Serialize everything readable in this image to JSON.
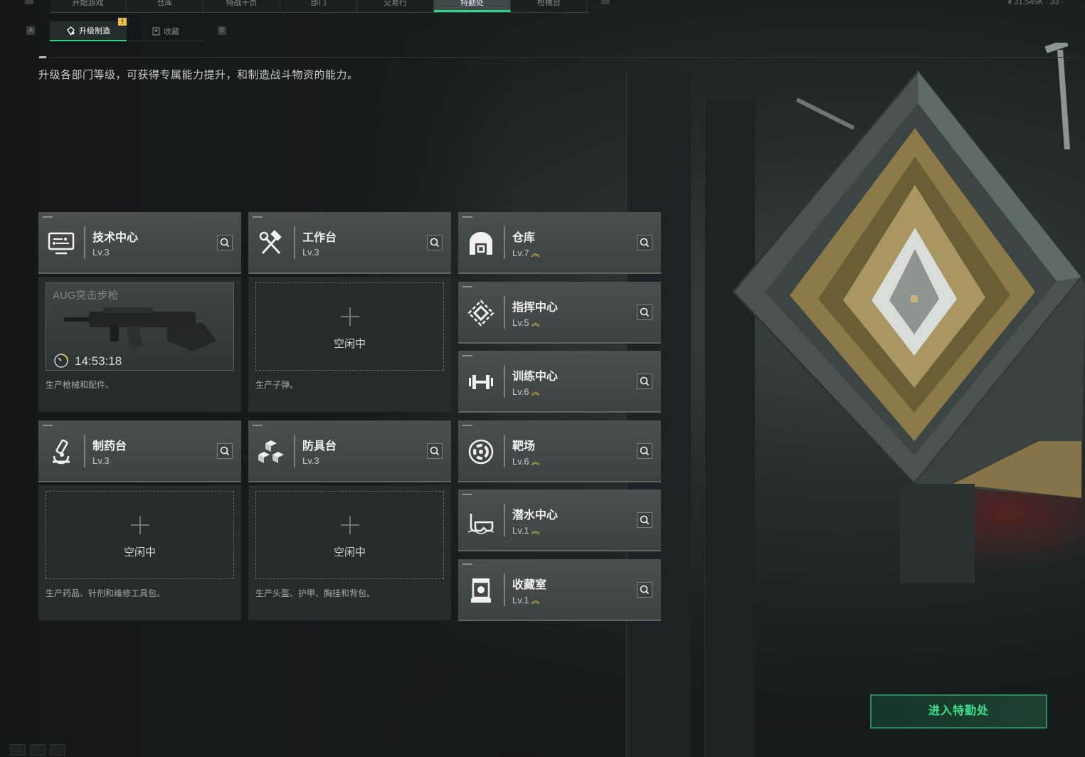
{
  "nav": {
    "key_left": "A",
    "key_right": "D",
    "tabs": [
      {
        "label": "开始游戏",
        "active": false
      },
      {
        "label": "仓库",
        "active": false
      },
      {
        "label": "特战干员",
        "active": false
      },
      {
        "label": "部门",
        "active": false
      },
      {
        "label": "交易行",
        "active": false
      },
      {
        "label": "特勤处",
        "active": true
      },
      {
        "label": "枪械台",
        "active": false
      }
    ],
    "currency": "¥ 31,545K · 33 ·"
  },
  "subtabs": {
    "upgrade_label": "升级制造",
    "upgrade_badge": "!",
    "collection_label": "收藏"
  },
  "description": "升级各部门等级，可获得专属能力提升，和制造战斗物资的能力。",
  "stations": {
    "tech_center": {
      "name": "技术中心",
      "level": "Lv.3",
      "icon": "monitor-icon",
      "crafting": {
        "item": "AUG突击步枪",
        "timer": "14:53:18"
      },
      "desc": "生产枪械和配件。"
    },
    "workbench": {
      "name": "工作台",
      "level": "Lv.3",
      "icon": "hammer-wrench-icon",
      "idle": "空闲中",
      "desc": "生产子弹。"
    },
    "pharmacy": {
      "name": "制药台",
      "level": "Lv.3",
      "icon": "microscope-icon",
      "idle": "空闲中",
      "desc": "生产药品、针剂和维修工具包。"
    },
    "armor_bench": {
      "name": "防具台",
      "level": "Lv.3",
      "icon": "blocks-icon",
      "idle": "空闲中",
      "desc": "生产头盔、护甲、胸挂和背包。"
    }
  },
  "departments": [
    {
      "name": "仓库",
      "level": "Lv.7",
      "upgradable": true,
      "icon": "warehouse-icon"
    },
    {
      "name": "指挥中心",
      "level": "Lv.5",
      "upgradable": true,
      "icon": "command-icon"
    },
    {
      "name": "训练中心",
      "level": "Lv.6",
      "upgradable": true,
      "icon": "dumbbell-icon"
    },
    {
      "name": "靶场",
      "level": "Lv.6",
      "upgradable": true,
      "icon": "target-icon"
    },
    {
      "name": "潜水中心",
      "level": "Lv.1",
      "upgradable": true,
      "icon": "diving-mask-icon"
    },
    {
      "name": "收藏室",
      "level": "Lv.1",
      "upgradable": true,
      "icon": "display-case-icon"
    }
  ],
  "enter_button": "进入特勤处",
  "colors": {
    "accent": "#2ed686",
    "upgrade": "#e4c04c",
    "badge": "#e9c246"
  }
}
